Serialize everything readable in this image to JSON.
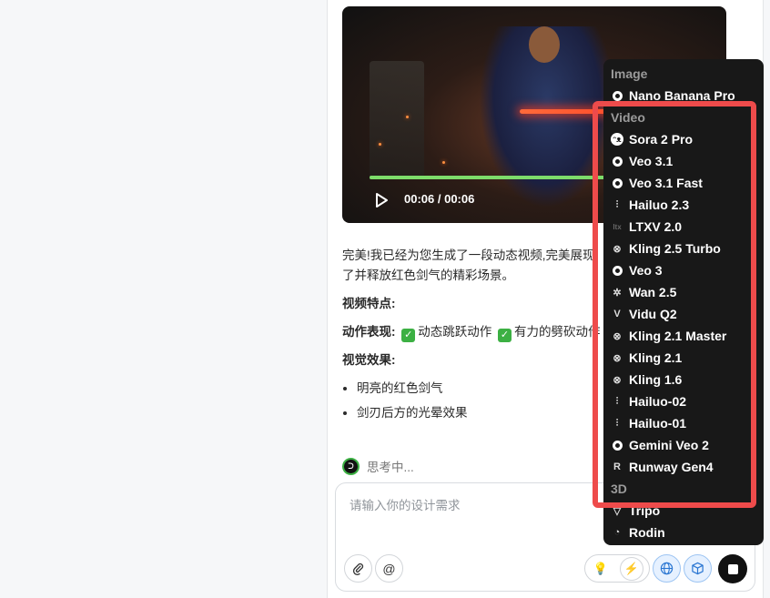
{
  "video": {
    "time": "00:06 / 00:06",
    "progress": 1.0
  },
  "message": {
    "intro": "完美!我已经为您生成了一段动态视频,完美展现了并释放红色剑气的精彩场景。",
    "features_heading": "视频特点:",
    "action_label": "动作表现:",
    "action_1": "动态跳跃动作",
    "action_2": "有力的劈砍动作",
    "visual_heading": "视觉效果:",
    "bullets": [
      "明亮的红色剑气",
      "剑刃后方的光晕效果"
    ]
  },
  "thinking": {
    "label": "思考中..."
  },
  "input": {
    "placeholder": "请输入你的设计需求"
  },
  "menu": {
    "sections": {
      "image": "Image",
      "video": "Video",
      "three_d": "3D"
    },
    "image_items": [
      {
        "label": "Nano Banana Pro",
        "icon": "ring-icon"
      }
    ],
    "video_items": [
      {
        "label": "Sora 2 Pro",
        "icon": "sora-icon"
      },
      {
        "label": "Veo 3.1",
        "icon": "ring-icon"
      },
      {
        "label": "Veo 3.1 Fast",
        "icon": "ring-icon"
      },
      {
        "label": "Hailuo 2.3",
        "icon": "waveform-icon"
      },
      {
        "label": "LTXV 2.0",
        "icon": "ltx-icon"
      },
      {
        "label": "Kling 2.5 Turbo",
        "icon": "kling-icon"
      },
      {
        "label": "Veo 3",
        "icon": "ring-icon"
      },
      {
        "label": "Wan 2.5",
        "icon": "wan-icon"
      },
      {
        "label": "Vidu Q2",
        "icon": "vidu-icon"
      },
      {
        "label": "Kling 2.1 Master",
        "icon": "kling-icon"
      },
      {
        "label": "Kling 2.1",
        "icon": "kling-icon"
      },
      {
        "label": "Kling 1.6",
        "icon": "kling-icon"
      },
      {
        "label": "Hailuo-02",
        "icon": "waveform-icon"
      },
      {
        "label": "Hailuo-01",
        "icon": "waveform-icon"
      },
      {
        "label": "Gemini Veo 2",
        "icon": "ring-icon"
      },
      {
        "label": "Runway Gen4",
        "icon": "runway-icon"
      }
    ],
    "three_d_items": [
      {
        "label": "Tripo",
        "icon": "tripo-icon"
      },
      {
        "label": "Rodin",
        "icon": "rodin-icon"
      }
    ]
  },
  "colors": {
    "highlight": "#ee4b4b",
    "menu_bg": "#181818",
    "check": "#3cb043"
  }
}
